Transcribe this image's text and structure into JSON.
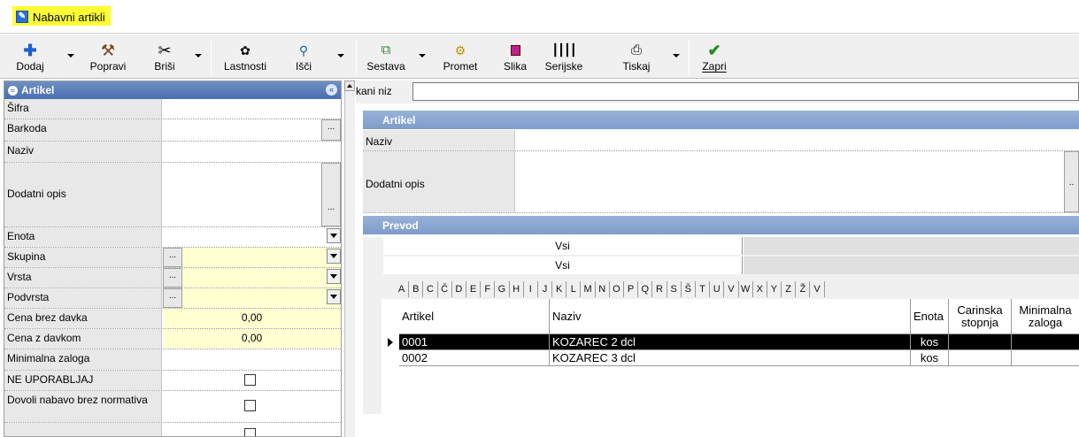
{
  "window": {
    "title": "Nabavni artikli"
  },
  "toolbar": {
    "dodaj": "Dodaj",
    "popravi": "Popravi",
    "brisi": "Briši",
    "lastnosti": "Lastnosti",
    "isci": "Išči",
    "sestava": "Sestava",
    "promet": "Promet",
    "slika": "Slika",
    "serijske": "Serijske",
    "tiskaj": "Tiskaj",
    "zapri": "Zapri"
  },
  "left": {
    "header": "Artikel",
    "fields": {
      "sifra": "Šifra",
      "barkoda": "Barkoda",
      "naziv": "Naziv",
      "dodatni_opis": "Dodatni opis",
      "enota": "Enota",
      "skupina": "Skupina",
      "vrsta": "Vrsta",
      "podvrsta": "Podvrsta",
      "cena_brez_davka": "Cena brez davka",
      "cena_brez_davka_val": "0,00",
      "cena_z_davkom": "Cena z davkom",
      "cena_z_davkom_val": "0,00",
      "minimalna_zaloga": "Minimalna zaloga",
      "ne_uporabljaj": "NE UPORABLJAJ",
      "dovoli_nabavo": "Dovoli nabavo brez normativa"
    },
    "dots": "..."
  },
  "right": {
    "search_label": "kani niz",
    "artikel_header": "Artikel",
    "naziv": "Naziv",
    "dodatni_opis": "Dodatni opis",
    "dots": "..",
    "prevod_header": "Prevod",
    "filter1": "Vsi",
    "filter2": "Vsi",
    "letters": [
      "A",
      "B",
      "C",
      "Č",
      "D",
      "E",
      "F",
      "G",
      "H",
      "I",
      "J",
      "K",
      "L",
      "M",
      "N",
      "O",
      "P",
      "Q",
      "R",
      "S",
      "Š",
      "T",
      "U",
      "V",
      "W",
      "X",
      "Y",
      "Z",
      "Ž",
      "V"
    ]
  },
  "grid": {
    "columns": [
      "Artikel",
      "Naziv",
      "Enota",
      "Carinska stopnja",
      "Minimalna zaloga"
    ],
    "rows": [
      {
        "artikel": "0001",
        "naziv": "KOZAREC 2 dcl",
        "enota": "kos",
        "carinska": "",
        "minimalna": ""
      },
      {
        "artikel": "0002",
        "naziv": "KOZAREC 3 dcl",
        "enota": "kos",
        "carinska": "",
        "minimalna": ""
      }
    ]
  }
}
